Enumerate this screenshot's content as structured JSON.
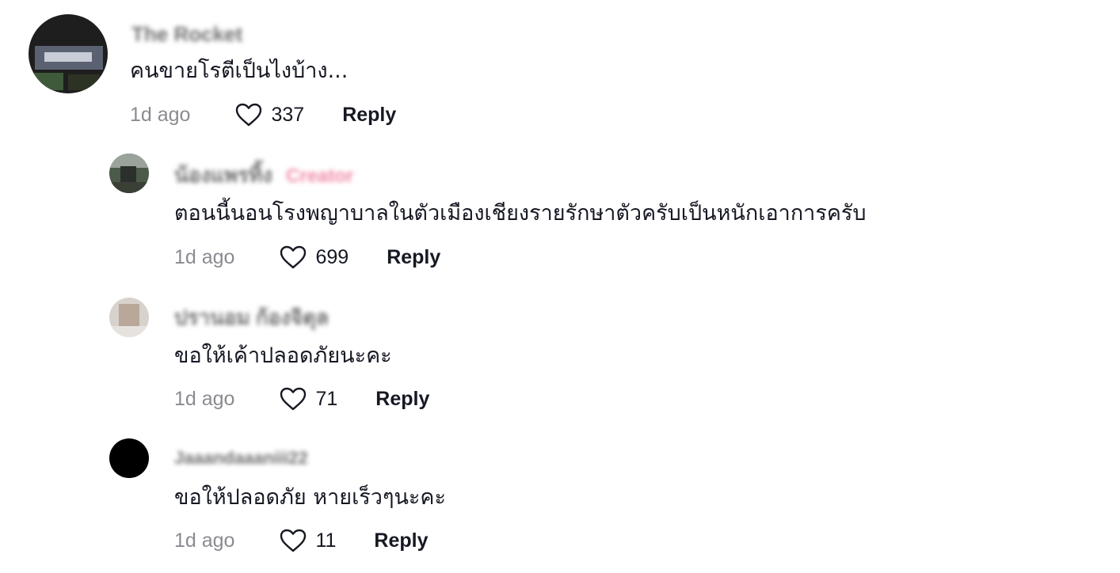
{
  "comments": [
    {
      "username": "The Rocket",
      "text": "คนขายโรตีเป็นไงบ้าง...",
      "time": "1d ago",
      "likes": "337",
      "reply_label": "Reply"
    },
    {
      "username": "น้องแพรทิ้ง",
      "creator_badge": "Creator",
      "text": "ตอนนี้นอนโรงพญาบาลในตัวเมืองเชียงรายรักษาตัวครับเป็นหนักเอาการครับ",
      "time": "1d ago",
      "likes": "699",
      "reply_label": "Reply"
    },
    {
      "username": "ปรานอม ก้องจิตุล",
      "text": "ขอให้เค้าปลอดภัยนะคะ",
      "time": "1d ago",
      "likes": "71",
      "reply_label": "Reply"
    },
    {
      "username": "Jaaandaaaniii22",
      "text": "ขอให้ปลอดภัย หายเร็วๆนะคะ",
      "time": "1d ago",
      "likes": "11",
      "reply_label": "Reply"
    }
  ],
  "icons": {
    "like": "heart-outline-icon"
  },
  "colors": {
    "text": "#161823",
    "muted": "#8a8b91",
    "creator": "#f08aa6"
  }
}
